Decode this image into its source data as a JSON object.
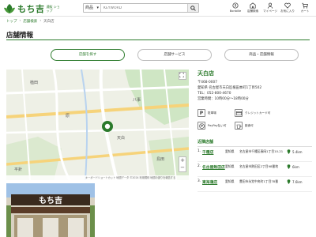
{
  "header": {
    "logo_text": "もち吉",
    "logo_sub": "通販 ショップ",
    "search_category": "商品",
    "search_placeholder": "KEYWORD",
    "icons": [
      {
        "label": "Bonbille",
        "icon": "bonbille-icon"
      },
      {
        "label": "店舗検索",
        "icon": "store-icon"
      },
      {
        "label": "マイページ",
        "icon": "user-icon"
      },
      {
        "label": "お気に入り",
        "icon": "heart-icon"
      },
      {
        "label": "カート",
        "icon": "cart-icon"
      }
    ]
  },
  "breadcrumb": [
    "トップ",
    "店舗検索",
    "天白店"
  ],
  "page_title": "店舗情報",
  "tabs": [
    "店舗を探す",
    "店舗サービス",
    "商品・店舗情報"
  ],
  "store": {
    "name": "天白店",
    "postal": "〒468-0007",
    "address": "愛知県 名古屋市天白区植田本町1丁目502",
    "tel": "TEL：052-800-4670",
    "hours": "営業時間：10時00分～18時00分",
    "services": [
      {
        "icon": "P",
        "label": "駐車場"
      },
      {
        "label": "クレジットカード可",
        "icon": "card-icon"
      },
      {
        "label": "PayPay払い可",
        "icon": "paypay-icon"
      },
      {
        "label": "飲食可",
        "icon": "drink-icon"
      }
    ]
  },
  "nearby": {
    "title": "近隣店舗",
    "stores": [
      {
        "num": "1.",
        "name": "千種店",
        "pref": "愛知県",
        "address": "名古屋市千種区春岡1丁目10-21",
        "distance": "5.4km"
      },
      {
        "num": "2.",
        "name": "名古屋熱田店",
        "pref": "愛知県",
        "address": "名古屋市熱田区2丁目98番地",
        "distance": "6km"
      },
      {
        "num": "3.",
        "name": "東海蒲店",
        "pref": "愛知県",
        "address": "豊田市永覚中央町1丁目78番",
        "distance": "7.6km"
      }
    ]
  },
  "map": {
    "footer": "キーボードショートカット 地図データ ©2024 利用規約 地図の誤りを報告する",
    "labels": [
      "天白",
      "植田",
      "平針",
      "八事",
      "原",
      "島田"
    ]
  },
  "photo": {
    "sign_text": "もち吉"
  }
}
